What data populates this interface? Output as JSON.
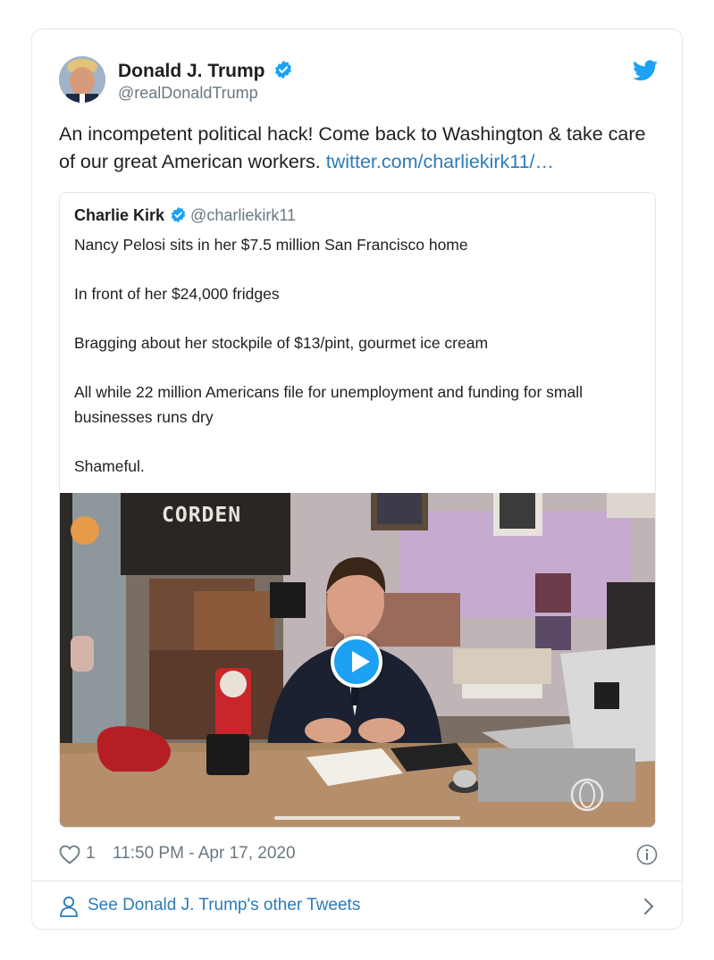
{
  "tweet": {
    "author_name": "Donald J. Trump",
    "author_handle": "@realDonaldTrump",
    "text": "An incompetent political hack! Come back to Washington & take care of our great American workers.",
    "link": "twitter.com/charliekirk11/…",
    "like_count": "1",
    "timestamp": "11:50 PM - Apr 17, 2020"
  },
  "quoted": {
    "author_name": "Charlie Kirk",
    "author_handle": "@charliekirk11",
    "paragraphs": [
      "Nancy Pelosi sits in her $7.5 million San Francisco home",
      "In front of her $24,000 fridges",
      "Bragging about her stockpile of $13/pint, gourmet ice cream",
      "All while 22 million Americans file for unemployment and funding for small businesses runs dry",
      "Shameful."
    ],
    "video": {
      "sign_text": "CORDEN"
    }
  },
  "footer": {
    "link_label": "See Donald J. Trump's other Tweets"
  },
  "colors": {
    "link": "#2b7bb9",
    "brand": "#1da1f2",
    "secondary_text": "#697882",
    "border": "#e1e8ed"
  },
  "icons": [
    "verified-badge-icon",
    "twitter-bird-icon",
    "play-icon",
    "heart-icon",
    "info-icon",
    "person-icon",
    "chevron-right-icon"
  ]
}
